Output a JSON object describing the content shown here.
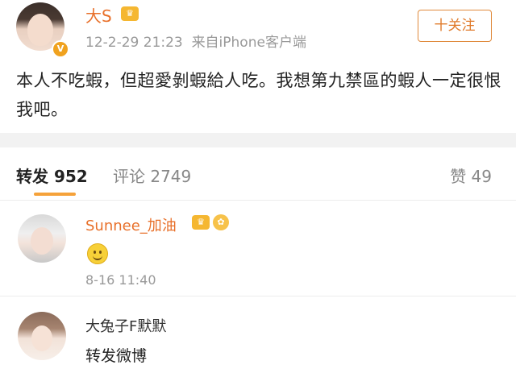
{
  "post": {
    "author": "大S",
    "author_badge_icon": "crown-icon",
    "verified_icon": "v-badge-icon",
    "timestamp": "12-2-29 21:23",
    "source": "来自iPhone客户端",
    "follow_label": "十关注",
    "text": "本人不吃蝦，但超愛剝蝦給人吃。我想第九禁區的蝦人一定很恨我吧。"
  },
  "tabs": {
    "repost": "转发 952",
    "comment": "评论 2749",
    "like": "赞 49",
    "active_color": "#f5a23a"
  },
  "comments": [
    {
      "name": "Sunnee_加油",
      "badges": [
        "member-crown-icon",
        "vip-icon"
      ],
      "content_icon": "smiley-emoji-icon",
      "time": "8-16 11:40"
    },
    {
      "name": "大兔子F默默",
      "text": "转发微博"
    }
  ],
  "colors": {
    "username_orange": "#e8702a",
    "meta_gray": "#999999"
  }
}
